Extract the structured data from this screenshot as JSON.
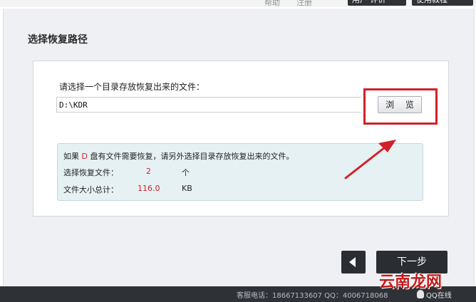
{
  "topbar": {
    "link1": "帮助",
    "link2": "注册",
    "btn1": "用户 评价",
    "btn2": "使用教程"
  },
  "page": {
    "title": "选择恢复路径",
    "prompt": "请选择一个目录存放恢复出来的文件：",
    "path_value": "D:\\KDR",
    "browse_label": "浏 览"
  },
  "info": {
    "line1_prefix": "如果 ",
    "drive": "D",
    "line1_suffix": " 盘有文件需要恢复，请另外选择目录存放恢复出来的文件。",
    "files_label": "选择恢复文件：",
    "files_count": "2",
    "files_unit": "个",
    "size_label": "文件大小总计：",
    "size_value": "116.0",
    "size_unit": "KB"
  },
  "nav": {
    "next_label": "下一步"
  },
  "footer": {
    "contact": "客服电话：18667133607 QQ：4006718068",
    "qq_status": "QQ在线"
  },
  "watermark": "云南龙网",
  "colors": {
    "accent_red": "#d0222a",
    "dark_button": "#2a2d32"
  }
}
